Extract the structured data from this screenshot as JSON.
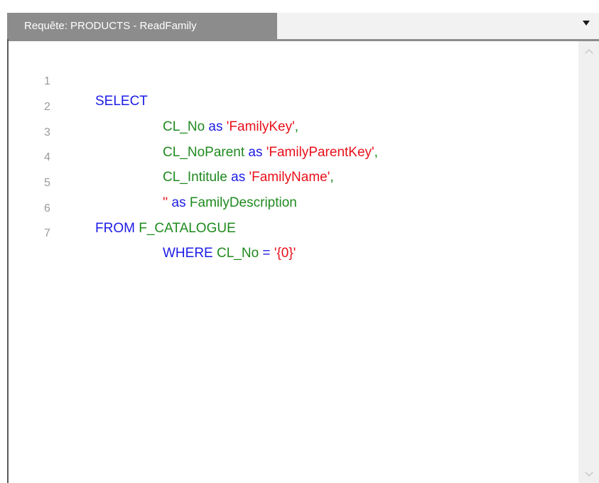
{
  "tab": {
    "title": "Requête: PRODUCTS - ReadFamily"
  },
  "colors": {
    "keyword": "#1c1ce6",
    "identifier": "#1f8a1f",
    "string": "#e8101a",
    "line_number": "#9a9a9a",
    "tab_background": "#8c8c8c"
  },
  "icons": {
    "dropdown": "dropdown-arrow-icon",
    "scroll_up": "chevron-up-icon",
    "scroll_down": "chevron-down-icon"
  },
  "editor": {
    "lines": [
      {
        "number": "1",
        "tokens": [
          {
            "type": "kw",
            "text": "SELECT"
          }
        ]
      },
      {
        "number": "2",
        "tokens": [
          {
            "type": "id",
            "text": "CL_No"
          },
          {
            "type": "kw",
            "text": " as "
          },
          {
            "type": "str",
            "text": "'FamilyKey'"
          },
          {
            "type": "id",
            "text": ","
          }
        ]
      },
      {
        "number": "3",
        "tokens": [
          {
            "type": "id",
            "text": "CL_NoParent"
          },
          {
            "type": "kw",
            "text": " as "
          },
          {
            "type": "str",
            "text": "'FamilyParentKey'"
          },
          {
            "type": "id",
            "text": ","
          }
        ]
      },
      {
        "number": "4",
        "tokens": [
          {
            "type": "id",
            "text": "CL_Intitule"
          },
          {
            "type": "kw",
            "text": " as "
          },
          {
            "type": "str",
            "text": "'FamilyName'"
          },
          {
            "type": "id",
            "text": ","
          }
        ]
      },
      {
        "number": "5",
        "tokens": [
          {
            "type": "str",
            "text": "''"
          },
          {
            "type": "kw",
            "text": " as "
          },
          {
            "type": "id",
            "text": "FamilyDescription"
          }
        ]
      },
      {
        "number": "6",
        "tokens": [
          {
            "type": "kw",
            "text": "FROM "
          },
          {
            "type": "id",
            "text": "F_CATALOGUE"
          }
        ]
      },
      {
        "number": "7",
        "tokens": [
          {
            "type": "kw",
            "text": "WHERE "
          },
          {
            "type": "id",
            "text": "CL_No"
          },
          {
            "type": "kw",
            "text": " = "
          },
          {
            "type": "str",
            "text": "'{0}'"
          }
        ]
      }
    ]
  }
}
